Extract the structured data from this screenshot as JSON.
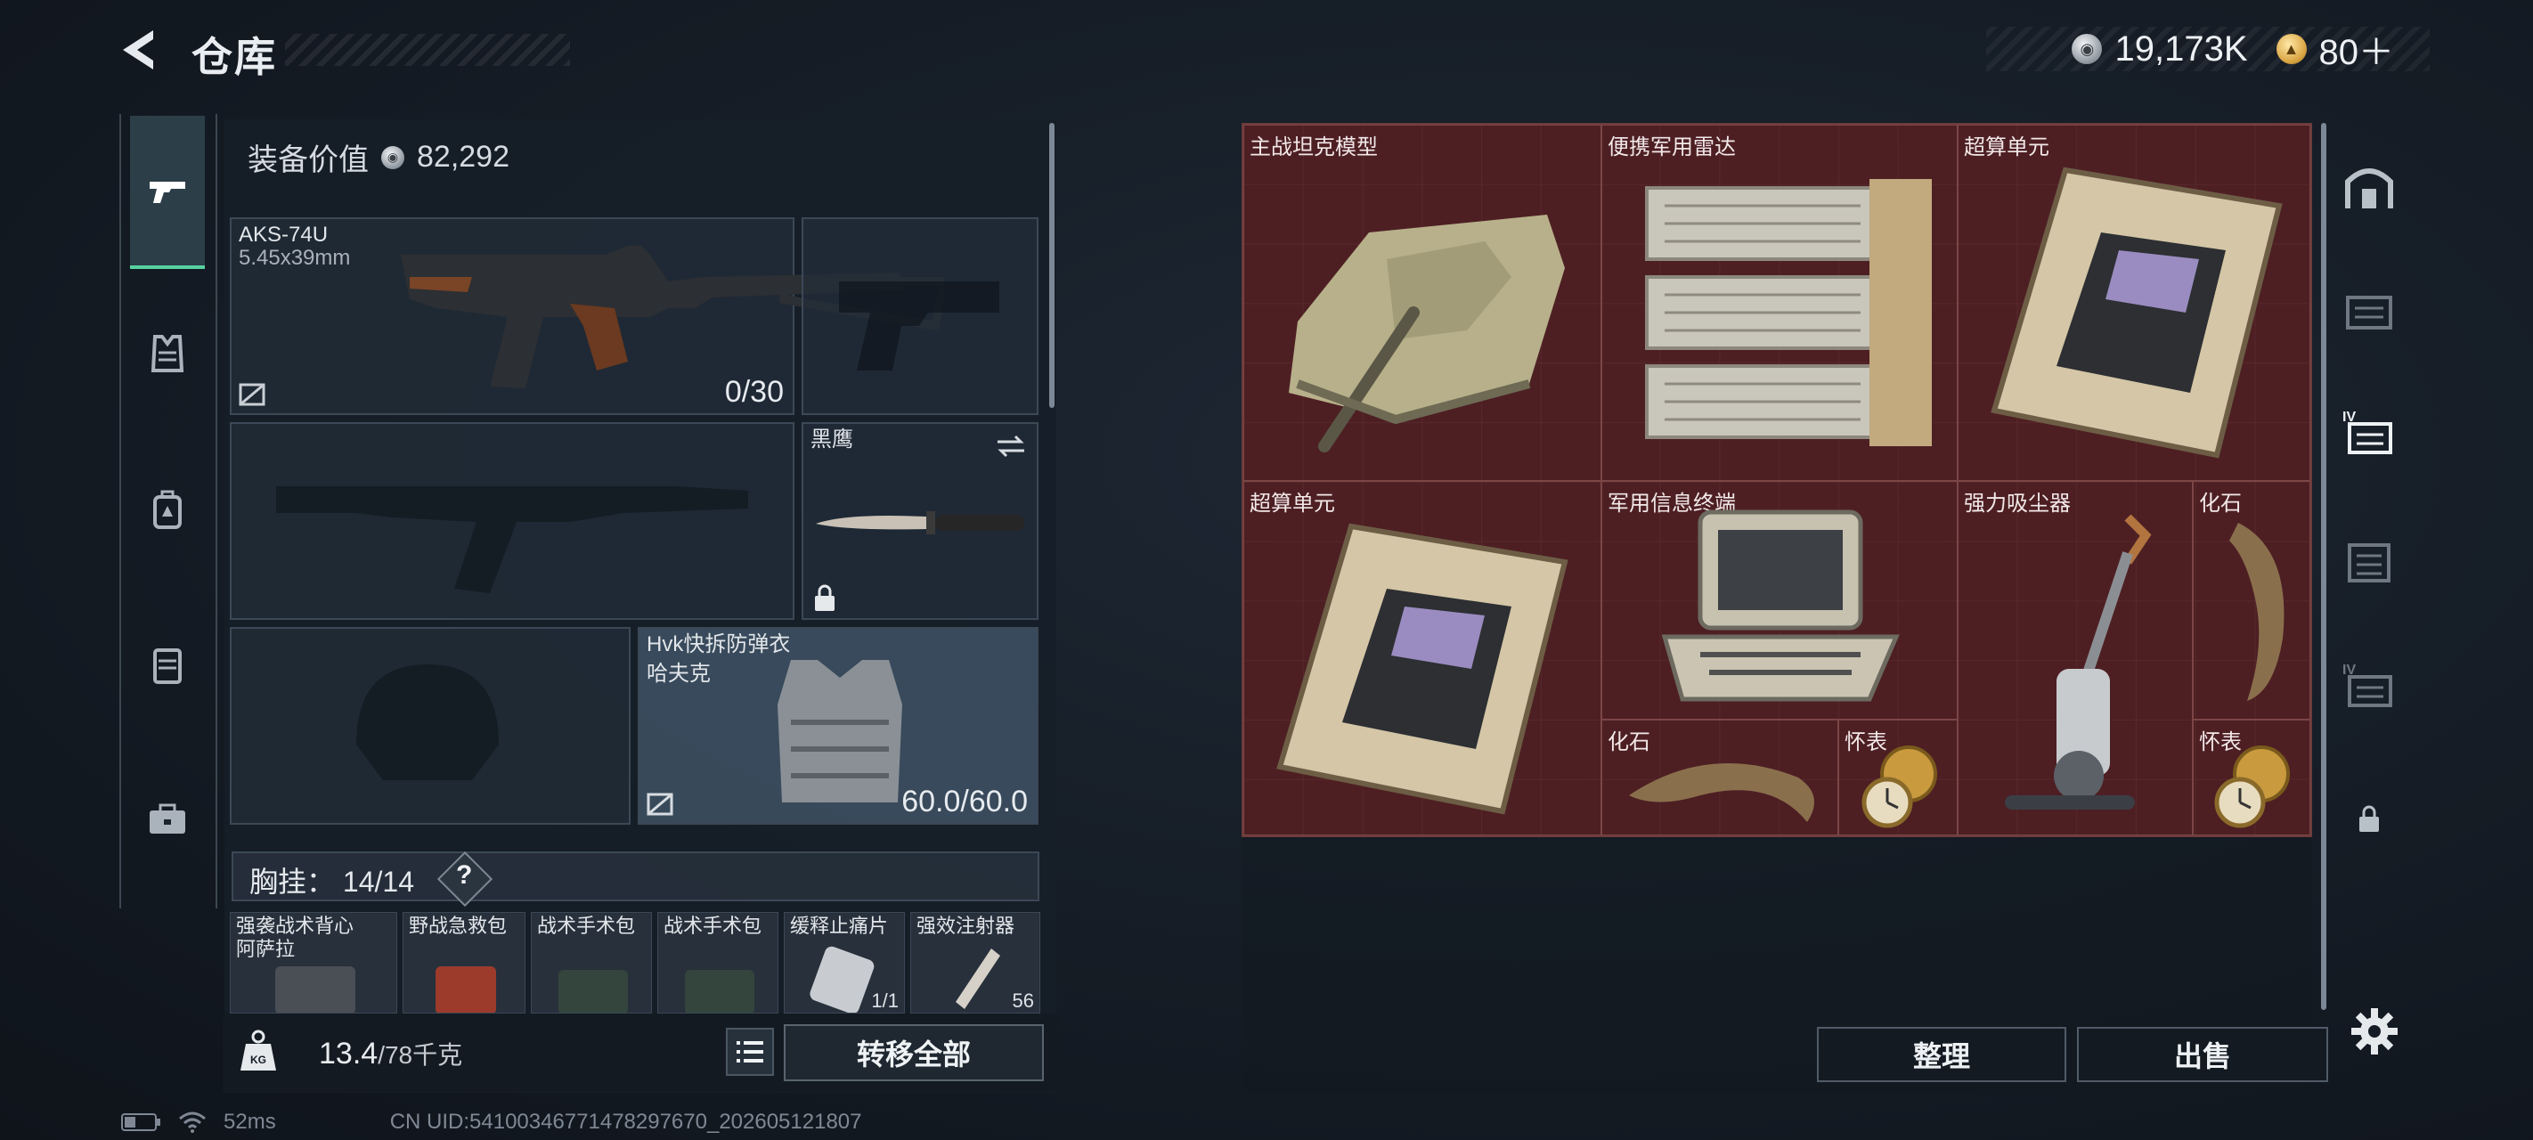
{
  "header": {
    "title": "仓库"
  },
  "currency": {
    "silver": "19,173K",
    "gold": "80＋"
  },
  "equipment": {
    "value_label": "装备价值",
    "value": "82,292",
    "primary": {
      "name": "AKS-74U",
      "ammo": "5.45x39mm",
      "count": "0/30"
    },
    "melee": {
      "name": "黑鹰"
    },
    "armor": {
      "name": "Hvk快拆防弹衣",
      "brand": "哈夫克",
      "durability": "60.0/60.0"
    },
    "chest_rig": {
      "label": "胸挂：",
      "capacity": "14/14",
      "help": "?"
    },
    "rig_items": [
      "强袭战术背心",
      "野战急救包",
      "战术手术包",
      "战术手术包",
      "缓释止痛片",
      "强效注射器"
    ],
    "rig_item_sub": "阿萨拉",
    "rig_item_counts": {
      "painkiller": "1/1",
      "injector": "56"
    }
  },
  "footer": {
    "weight": "13.4",
    "weight_max": "/78千克",
    "transfer_all": "转移全部"
  },
  "status": {
    "ping": "52ms",
    "uid": "CN UID:54100346771478297670_202605121807"
  },
  "stash": {
    "items": [
      "主战坦克模型",
      "便携军用雷达",
      "超算单元",
      "超算单元",
      "军用信息终端",
      "强力吸尘器",
      "化石",
      "化石",
      "怀表",
      "怀表"
    ]
  },
  "actions": {
    "sort": "整理",
    "sell": "出售"
  },
  "side_badges": {
    "iv": "IV"
  },
  "colors": {
    "accent": "#57d1a2",
    "stash_bg": "#4a1e22"
  }
}
